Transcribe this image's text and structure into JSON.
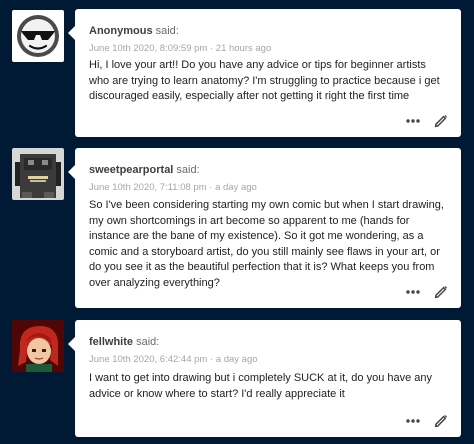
{
  "posts": [
    {
      "asker": "Anonymous",
      "said": " said:",
      "timestamp": "June 10th 2020, 8:09:59 pm",
      "separator": " · ",
      "relative": "21 hours ago",
      "avatar": "anonymous-sunglasses-face",
      "question": "Hi, I love your art!! Do you have any advice or tips for beginner artists who are trying to learn anatomy? I'm struggling to practice because i get discouraged easily, especially after not getting it right the first time",
      "actions": [
        "more-options-icon",
        "edit-icon"
      ]
    },
    {
      "asker": "sweetpearportal",
      "said": " said:",
      "timestamp": "June 10th 2020, 7:11:08 pm",
      "separator": " · ",
      "relative": "a day ago",
      "avatar": "pixel-character-shirt",
      "question": "So I've been considering starting my own comic but when I start drawing, my own shortcomings in art become so apparent to me (hands for instance are the bane of my existence). So it got me wondering, as a comic and a storyboard artist, do you still mainly see flaws in your art, or do you see it as the beautiful perfection that it is? What keeps you from over analyzing everything?",
      "actions": [
        "more-options-icon",
        "edit-icon"
      ]
    },
    {
      "asker": "fellwhite",
      "said": " said:",
      "timestamp": "June 10th 2020, 6:42:44 pm",
      "separator": " · ",
      "relative": "a day ago",
      "avatar": "red-haired-character",
      "question": "I want to get into drawing but i completely SUCK at it, do you have any advice or know where to start? I'd really appreciate it",
      "actions": [
        "more-options-icon",
        "edit-icon"
      ]
    }
  ],
  "colors": {
    "background": "#001935",
    "card": "#ffffff",
    "name": "#3f3f3f",
    "meta": "#a6a6a6",
    "text": "#222222",
    "icon": "#444444"
  }
}
